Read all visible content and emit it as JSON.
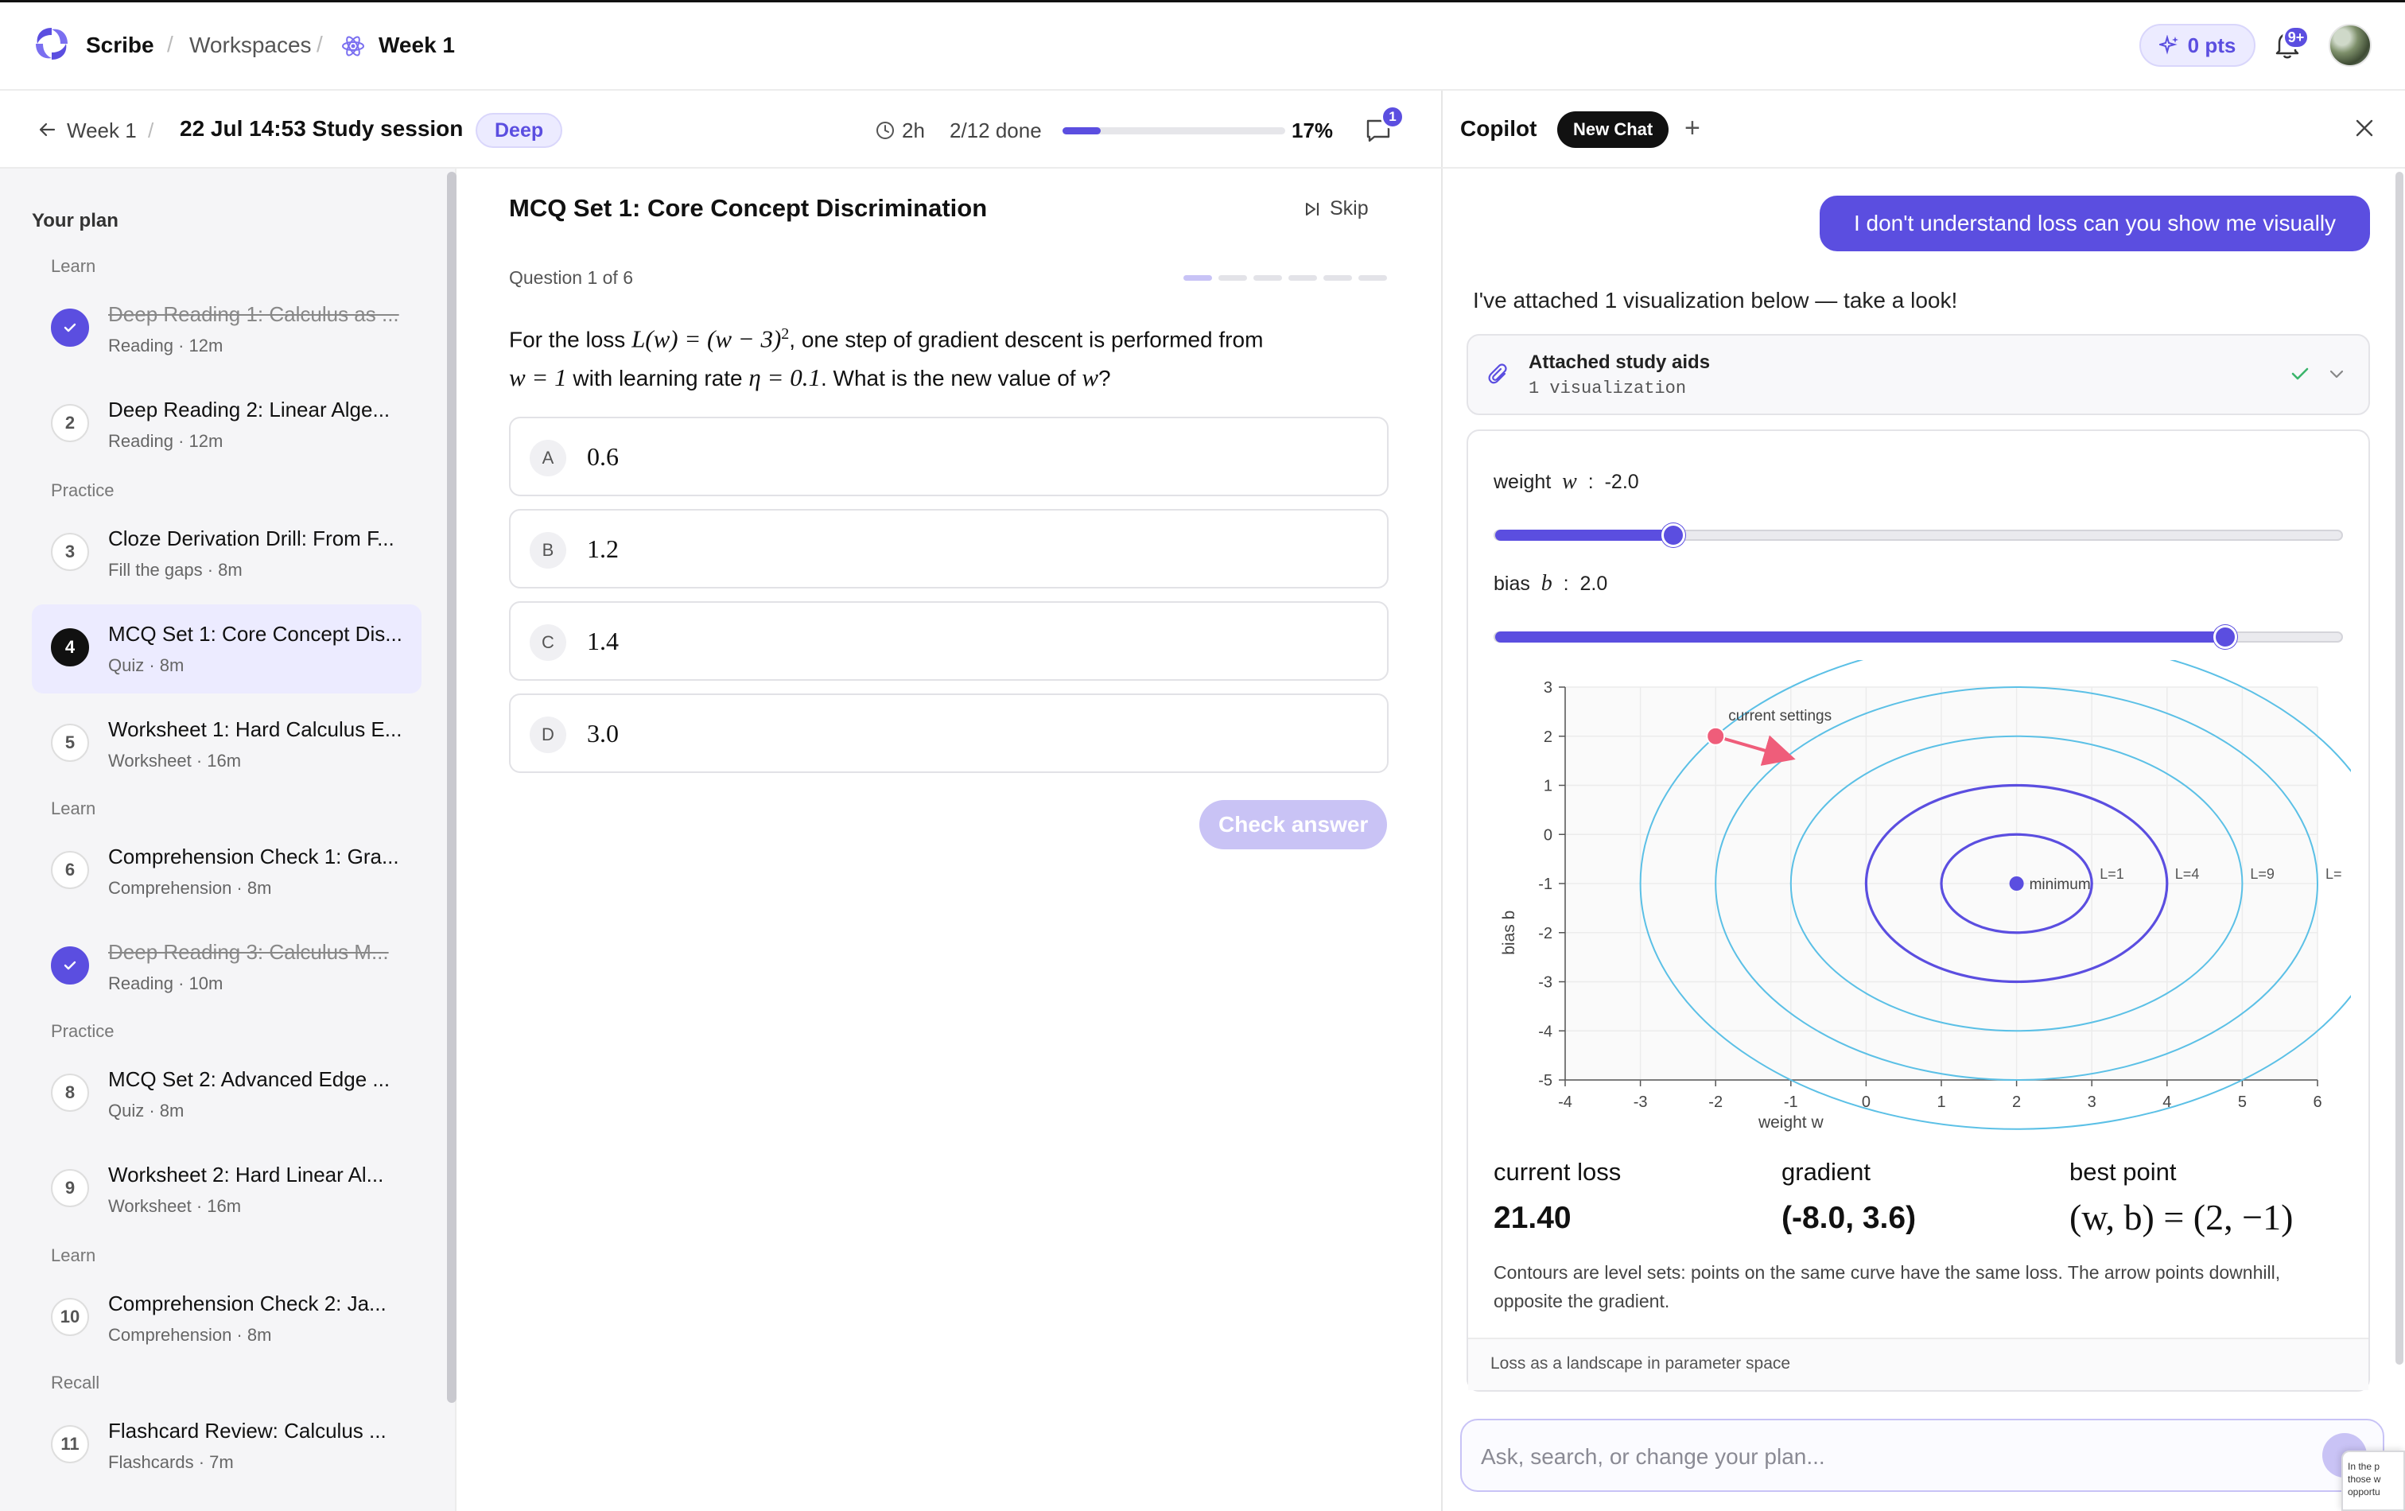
{
  "app": {
    "brand": "Scribe",
    "breadcrumbs": [
      "Workspaces",
      "Week 1"
    ],
    "points": "0 pts",
    "notification_badge": "9+",
    "accent": "#5b4ee0"
  },
  "session": {
    "back_label": "Week 1",
    "title": "22 Jul 14:53 Study session",
    "mode_badge": "Deep",
    "duration": "2h",
    "done": "2/12 done",
    "progress_percent": 17,
    "progress_label": "17%",
    "chat_badge": "1"
  },
  "sidebar": {
    "title": "Your plan",
    "sections": [
      "Learn",
      "Practice",
      "Learn",
      "Practice",
      "Learn",
      "Recall"
    ],
    "items": [
      {
        "num": "1",
        "title": "Deep Reading 1: Calculus as ...",
        "sub": "Reading · 12m",
        "status": "done"
      },
      {
        "num": "2",
        "title": "Deep Reading 2: Linear Alge...",
        "sub": "Reading · 12m",
        "status": "todo"
      },
      {
        "num": "3",
        "title": "Cloze Derivation Drill: From F...",
        "sub": "Fill the gaps · 8m",
        "status": "todo"
      },
      {
        "num": "4",
        "title": "MCQ Set 1: Core Concept Dis...",
        "sub": "Quiz · 8m",
        "status": "current"
      },
      {
        "num": "5",
        "title": "Worksheet 1: Hard Calculus E...",
        "sub": "Worksheet · 16m",
        "status": "todo"
      },
      {
        "num": "6",
        "title": "Comprehension Check 1: Gra...",
        "sub": "Comprehension · 8m",
        "status": "todo"
      },
      {
        "num": "7",
        "title": "Deep Reading 3: Calculus M...",
        "sub": "Reading · 10m",
        "status": "done"
      },
      {
        "num": "8",
        "title": "MCQ Set 2: Advanced Edge ...",
        "sub": "Quiz · 8m",
        "status": "todo"
      },
      {
        "num": "9",
        "title": "Worksheet 2: Hard Linear Al...",
        "sub": "Worksheet · 16m",
        "status": "todo"
      },
      {
        "num": "10",
        "title": "Comprehension Check 2: Ja...",
        "sub": "Comprehension · 8m",
        "status": "todo"
      },
      {
        "num": "11",
        "title": "Flashcard Review: Calculus ...",
        "sub": "Flashcards · 7m",
        "status": "todo"
      }
    ]
  },
  "quiz": {
    "title": "MCQ Set 1: Core Concept Discrimination",
    "skip_label": "Skip",
    "question_counter": "Question 1 of 6",
    "question_count": 6,
    "current_question": 1,
    "question_parts": {
      "p1": "For the loss ",
      "m1": "L(w) = (w − 3)",
      "m1_sup": "2",
      "p2": ", one step of gradient descent is performed from ",
      "m2": "w = 1",
      "p3": " with learning rate ",
      "m3": "η = 0.1",
      "p4": ". What is the new value of ",
      "m4": "w",
      "p5": "?"
    },
    "options": [
      {
        "letter": "A",
        "value": "0.6"
      },
      {
        "letter": "B",
        "value": "1.2"
      },
      {
        "letter": "C",
        "value": "1.4"
      },
      {
        "letter": "D",
        "value": "3.0"
      }
    ],
    "check_label": "Check answer"
  },
  "copilot": {
    "title": "Copilot",
    "new_chat_label": "New Chat",
    "user_message": "I don't understand loss can you show me visually",
    "ai_message": "I've attached 1 visualization below — take a look!",
    "aids_title": "Attached study aids",
    "aids_sub": "1 visualization",
    "input_placeholder": "Ask, search, or change your plan...",
    "peek_text": "In the p those w opportu"
  },
  "viz": {
    "weight_label": "weight",
    "weight_symbol": "w",
    "weight_value": "-2.0",
    "weight_fraction": 0.21,
    "bias_label": "bias",
    "bias_symbol": "b",
    "bias_value": "2.0",
    "bias_fraction": 0.86,
    "stats": [
      {
        "label": "current loss",
        "value": "21.40"
      },
      {
        "label": "gradient",
        "value": "(-8.0, 3.6)"
      },
      {
        "label": "best point",
        "value": "(w, b) = (2, −1)"
      }
    ],
    "caption": "Contours are level sets: points on the same curve have the same loss. The arrow points downhill, opposite the gradient.",
    "footer": "Loss as a landscape in parameter space"
  },
  "chart_data": {
    "type": "scatter",
    "title": "",
    "xlabel": "weight w",
    "ylabel": "bias b",
    "xlim": [
      -4,
      6
    ],
    "ylim": [
      -5,
      3
    ],
    "x_ticks": [
      -4,
      -3,
      -2,
      -1,
      0,
      1,
      2,
      3,
      4,
      5,
      6
    ],
    "y_ticks": [
      3,
      2,
      1,
      0,
      -1,
      -2,
      -3,
      -4,
      -5
    ],
    "grid": true,
    "minimum": {
      "w": 2,
      "b": -1,
      "label": "minimum"
    },
    "current": {
      "w": -2,
      "b": 2,
      "label": "current settings"
    },
    "arrow_to": {
      "w": -1.1,
      "b": 1.6
    },
    "contours": [
      {
        "level": 1,
        "label": "L=1",
        "radius": 1,
        "color": "#5b4ee0"
      },
      {
        "level": 4,
        "label": "L=4",
        "radius": 2,
        "color": "#5b4ee0"
      },
      {
        "level": 9,
        "label": "L=9",
        "radius": 3,
        "color": "#5bc0e6"
      },
      {
        "level": 16,
        "label": "L=",
        "radius": 4,
        "color": "#5bc0e6"
      },
      {
        "level": 25,
        "label": "",
        "radius": 5,
        "color": "#5bc0e6"
      }
    ],
    "minimum_color": "#5b4ee0",
    "current_color": "#ef5d7a"
  }
}
